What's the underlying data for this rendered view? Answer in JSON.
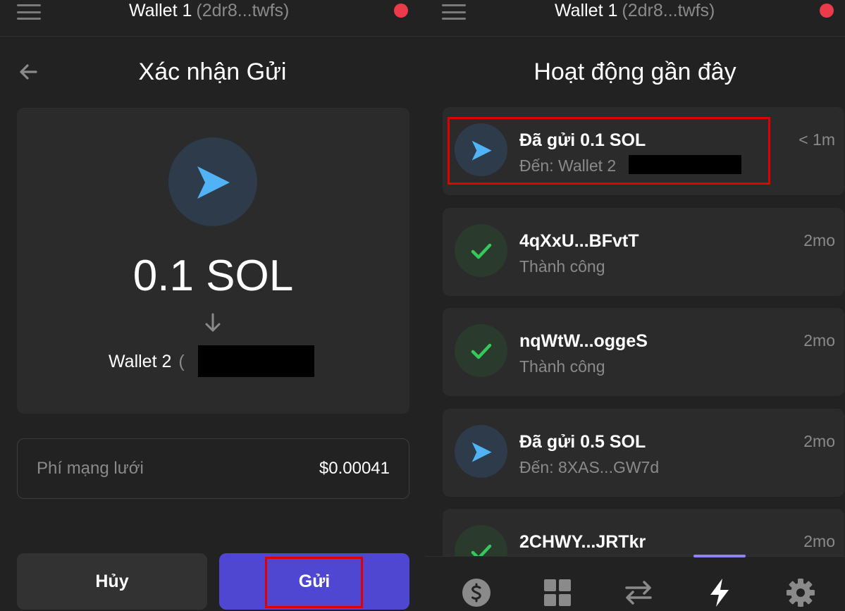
{
  "left": {
    "header": {
      "wallet_name": "Wallet 1",
      "wallet_address": "(2dr8...twfs)"
    },
    "title": "Xác nhận Gửi",
    "amount": "0.1 SOL",
    "recipient_name": "Wallet 2",
    "recipient_paren_open": "(",
    "recipient_paren_close": ")",
    "fee": {
      "label": "Phí mạng lưới",
      "value": "$0.00041"
    },
    "buttons": {
      "cancel": "Hủy",
      "send": "Gửi"
    }
  },
  "right": {
    "header": {
      "wallet_name": "Wallet 1",
      "wallet_address": "(2dr8...twfs)"
    },
    "title": "Hoạt động gần đây",
    "activities": [
      {
        "title": "Đã gửi 0.1 SOL",
        "subtitle": "Đến: Wallet 2",
        "time": "< 1m",
        "icon": "send-icon"
      },
      {
        "title": "4qXxU...BFvtT",
        "subtitle": "Thành công",
        "time": "2mo",
        "icon": "check-icon"
      },
      {
        "title": "nqWtW...oggeS",
        "subtitle": "Thành công",
        "time": "2mo",
        "icon": "check-icon"
      },
      {
        "title": "Đã gửi 0.5 SOL",
        "subtitle": "Đến: 8XAS...GW7d",
        "time": "2mo",
        "icon": "send-icon"
      },
      {
        "title": "2CHWY...JRTkr",
        "subtitle": "",
        "time": "2mo",
        "icon": "check-icon"
      }
    ],
    "tabs": [
      "dollar-icon",
      "grid-icon",
      "swap-icon",
      "lightning-icon",
      "gear-icon"
    ],
    "active_tab": "lightning-icon"
  },
  "colors": {
    "background": "#222222",
    "card": "#2b2b2b",
    "accent": "#4f46d1",
    "send_icon": "#4fb3f6",
    "success": "#35c85a",
    "status_dot": "#eb3b4a",
    "highlight": "#e00000"
  }
}
